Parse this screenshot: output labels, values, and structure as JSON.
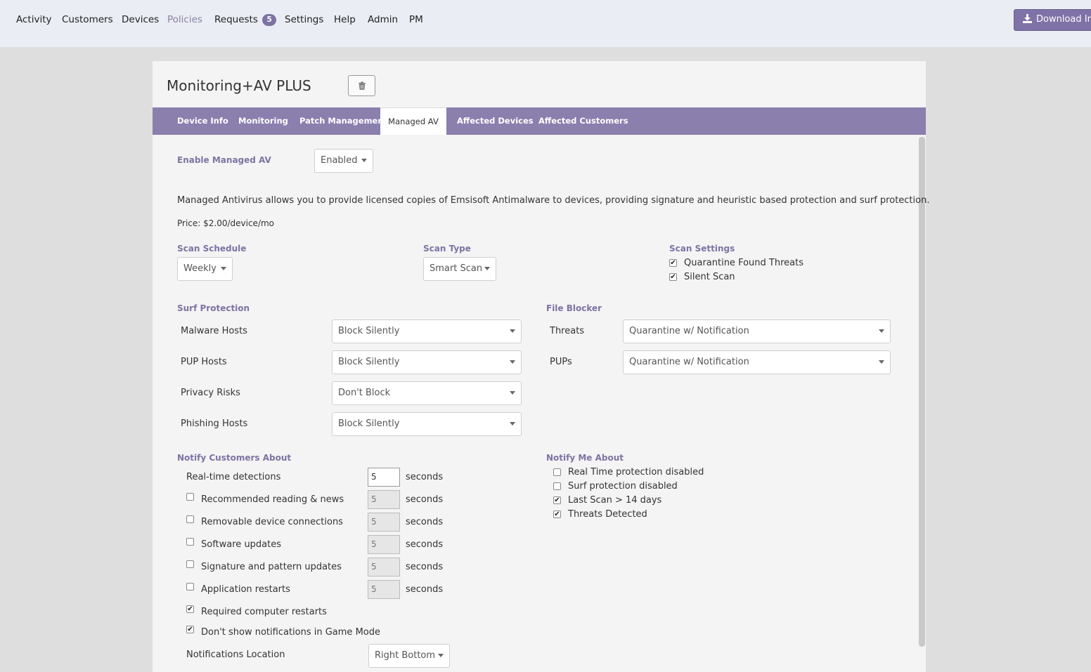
{
  "nav": {
    "items": [
      {
        "label": "Activity"
      },
      {
        "label": "Customers"
      },
      {
        "label": "Devices"
      },
      {
        "label": "Policies"
      },
      {
        "label": "Requests"
      },
      {
        "label": "Settings"
      },
      {
        "label": "Help"
      },
      {
        "label": "Admin"
      },
      {
        "label": "PM"
      }
    ],
    "requests_badge": "5",
    "download_label": "Download Ins"
  },
  "policy": {
    "title": "Monitoring+AV PLUS"
  },
  "tabs": [
    {
      "label": "Device Info"
    },
    {
      "label": "Monitoring"
    },
    {
      "label": "Patch Management"
    },
    {
      "label": "Managed AV"
    },
    {
      "label": "Affected Devices"
    },
    {
      "label": "Affected Customers"
    }
  ],
  "managed_av": {
    "enable_label": "Enable Managed AV",
    "enable_value": "Enabled",
    "description": "Managed Antivirus allows you to provide licensed copies of Emsisoft Antimalware to devices, providing signature and heuristic based protection and surf protection.",
    "price": "Price: $2.00/device/mo",
    "scan_schedule_label": "Scan Schedule",
    "scan_schedule_value": "Weekly",
    "scan_type_label": "Scan Type",
    "scan_type_value": "Smart Scan",
    "scan_settings_label": "Scan Settings",
    "scan_settings": [
      {
        "label": "Quarantine Found Threats",
        "checked": true
      },
      {
        "label": "Silent Scan",
        "checked": true
      }
    ],
    "surf_protection_label": "Surf Protection",
    "surf_protection": [
      {
        "label": "Malware Hosts",
        "value": "Block Silently"
      },
      {
        "label": "PUP Hosts",
        "value": "Block Silently"
      },
      {
        "label": "Privacy Risks",
        "value": "Don't Block"
      },
      {
        "label": "Phishing Hosts",
        "value": "Block Silently"
      }
    ],
    "file_blocker_label": "File Blocker",
    "file_blocker": [
      {
        "label": "Threats",
        "value": "Quarantine w/ Notification"
      },
      {
        "label": "PUPs",
        "value": "Quarantine w/ Notification"
      }
    ],
    "notify_customers_label": "Notify Customers About",
    "seconds_label": "seconds",
    "realtime": {
      "label": "Real-time detections",
      "value": "5"
    },
    "notify_customers": [
      {
        "label": "Recommended reading & news",
        "value": "5",
        "checked": false
      },
      {
        "label": "Removable device connections",
        "value": "5",
        "checked": false
      },
      {
        "label": "Software updates",
        "value": "5",
        "checked": false
      },
      {
        "label": "Signature and pattern updates",
        "value": "5",
        "checked": false
      },
      {
        "label": "Application restarts",
        "value": "5",
        "checked": false
      }
    ],
    "extra_options": [
      {
        "label": "Required computer restarts",
        "checked": true
      },
      {
        "label": "Don't show notifications in Game Mode",
        "checked": true
      }
    ],
    "notifications_location_label": "Notifications Location",
    "notifications_location_value": "Right Bottom",
    "notify_me_label": "Notify Me About",
    "notify_me": [
      {
        "label": "Real Time protection disabled",
        "checked": false
      },
      {
        "label": "Surf protection disabled",
        "checked": false
      },
      {
        "label": "Last Scan > 14 days",
        "checked": true
      },
      {
        "label": "Threats Detected",
        "checked": true
      }
    ]
  }
}
